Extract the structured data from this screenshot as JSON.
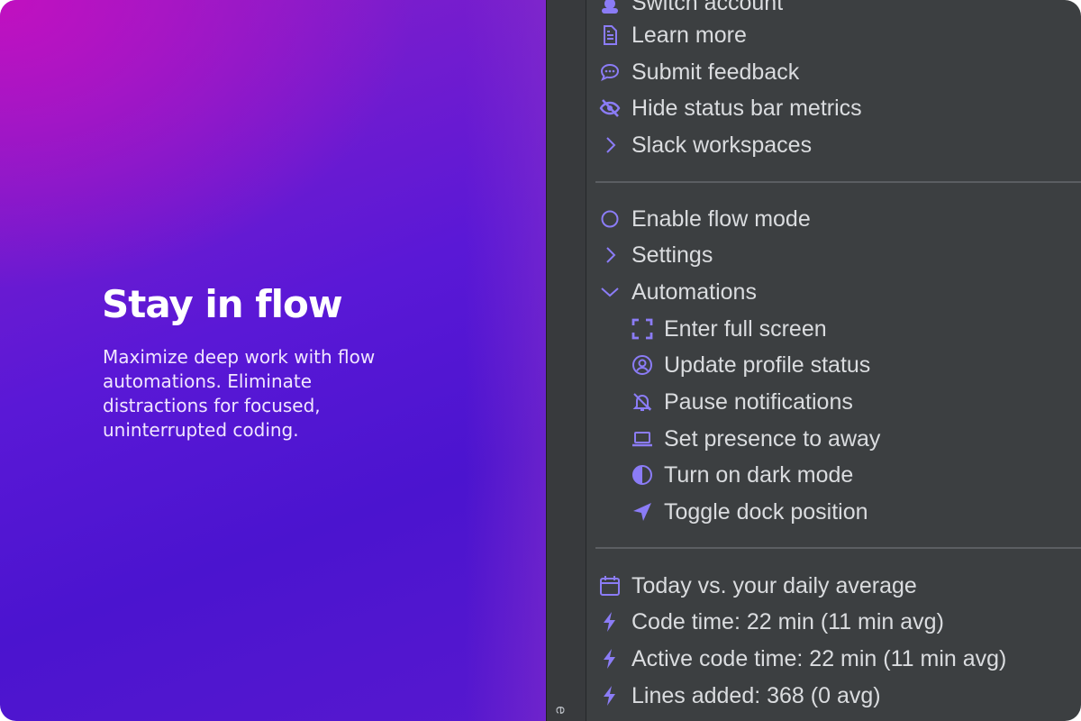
{
  "hero": {
    "title": "Stay in flow",
    "description": "Maximize deep work with flow automations. Eliminate distractions for focused, uninterrupted coding."
  },
  "strip": {
    "char": "e"
  },
  "menu": {
    "account": [
      {
        "label": "Switch account",
        "icon": "person-icon"
      },
      {
        "label": "Learn more",
        "icon": "document-icon"
      },
      {
        "label": "Submit feedback",
        "icon": "chat-bubble-icon"
      },
      {
        "label": "Hide status bar metrics",
        "icon": "eye-off-icon"
      },
      {
        "label": "Slack workspaces",
        "icon": "chevron-right-icon"
      }
    ],
    "flow": [
      {
        "label": "Enable flow mode",
        "icon": "circle-icon"
      },
      {
        "label": "Settings",
        "icon": "chevron-right-icon"
      },
      {
        "label": "Automations",
        "icon": "chevron-down-icon"
      }
    ],
    "automations": [
      {
        "label": "Enter full screen",
        "icon": "fullscreen-icon"
      },
      {
        "label": "Update profile status",
        "icon": "profile-icon"
      },
      {
        "label": "Pause notifications",
        "icon": "bell-off-icon"
      },
      {
        "label": "Set presence to away",
        "icon": "laptop-icon"
      },
      {
        "label": "Turn on dark mode",
        "icon": "contrast-icon"
      },
      {
        "label": "Toggle dock position",
        "icon": "navigation-arrow-icon"
      }
    ],
    "metrics": [
      {
        "label": "Today vs. your daily average",
        "icon": "calendar-icon"
      },
      {
        "label": "Code time: 22 min (11 min avg)",
        "icon": "bolt-icon"
      },
      {
        "label": "Active code time: 22 min (11 min avg)",
        "icon": "bolt-icon"
      },
      {
        "label": "Lines added: 368 (0 avg)",
        "icon": "bolt-icon"
      }
    ]
  },
  "colors": {
    "accent": "#8b7cf6",
    "panel_bg": "#3c3f41",
    "text": "#dadcdf",
    "separator": "#5b5e62"
  }
}
